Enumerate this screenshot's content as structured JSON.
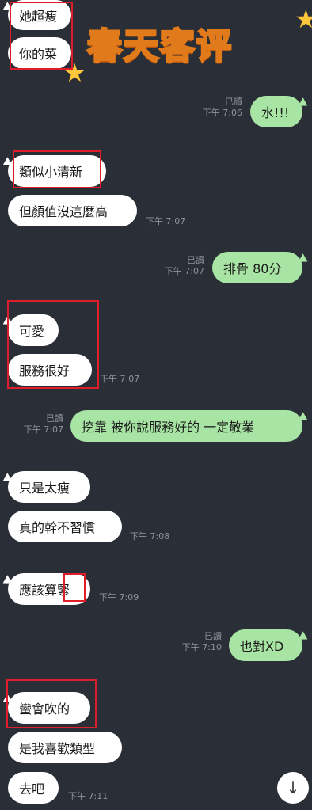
{
  "banner": {
    "title": "春天客评"
  },
  "messages": [
    {
      "text": "她超瘦"
    },
    {
      "text": "你的菜"
    },
    {
      "text": "水!!!",
      "read": "已讀",
      "time": "下午 7:06"
    },
    {
      "text": "類似小清新"
    },
    {
      "text": "但顏值沒這麼高",
      "time": "下午 7:07"
    },
    {
      "text": "排骨 80分",
      "read": "已讀",
      "time": "下午 7:07"
    },
    {
      "text": "可愛"
    },
    {
      "text": "服務很好",
      "time": "下午 7:07"
    },
    {
      "text": "挖靠 被你說服務好的 一定敬業",
      "read": "已讀",
      "time": "下午 7:07"
    },
    {
      "text": "只是太瘦"
    },
    {
      "text": "真的幹不習慣",
      "time": "下午 7:08"
    },
    {
      "text": "應該算緊",
      "time": "下午 7:09"
    },
    {
      "text": "也對XD",
      "read": "已讀",
      "time": "下午 7:10"
    },
    {
      "text": "蠻會吹的"
    },
    {
      "text": "是我喜歡類型"
    },
    {
      "text": "去吧",
      "time": "下午 7:11"
    }
  ],
  "scroll_button": {
    "icon": "arrow-down-icon",
    "glyph": "↓"
  },
  "colors": {
    "background": "#2a2e37",
    "incoming": "#ffffff",
    "outgoing": "#a8e5a4",
    "highlight": "#e01e2a",
    "banner": "#fde58a"
  }
}
